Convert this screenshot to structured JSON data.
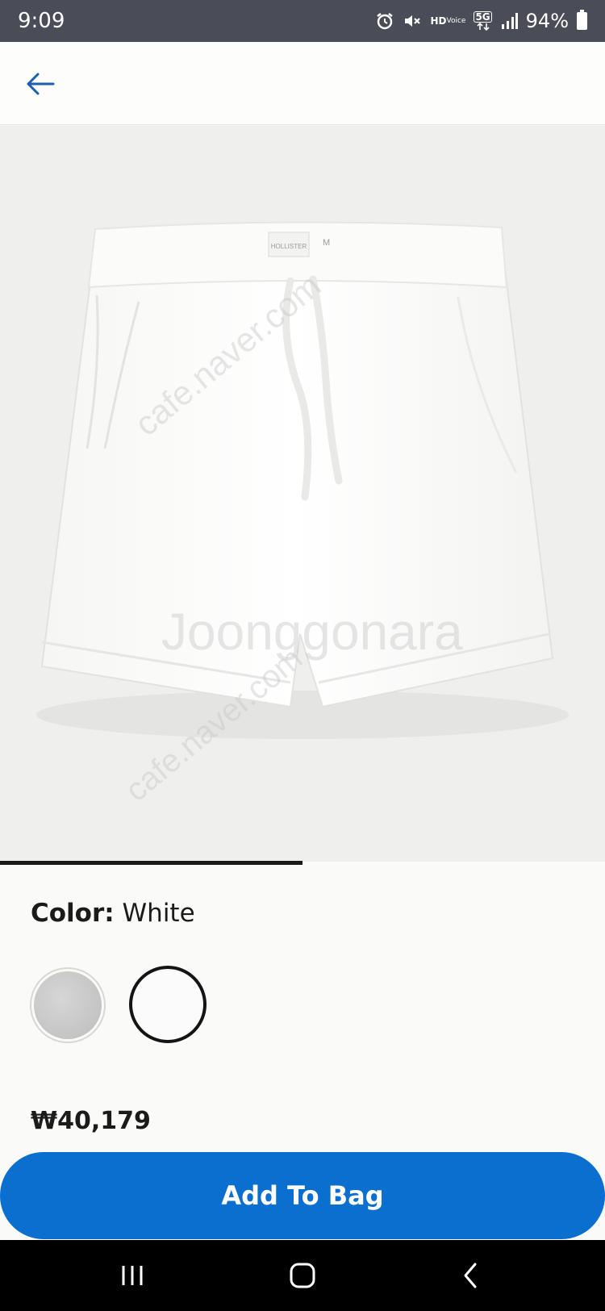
{
  "status_bar": {
    "time": "9:09",
    "battery": "94%",
    "icons": [
      "alarm-icon",
      "mute-icon",
      "hd-voice-icon",
      "5g-icon",
      "signal-icon",
      "battery-icon"
    ],
    "hd_top": "HD",
    "hd_bottom": "Voice",
    "network": "5G"
  },
  "header": {
    "back_icon": "arrow-left-icon"
  },
  "product": {
    "image_brand_tag": "HOLLISTER",
    "image_size_tag": "M",
    "watermarks": [
      "cafe.naver.com",
      "Joonggonara",
      "joonggonara"
    ]
  },
  "color": {
    "label": "Color:",
    "value": "White",
    "swatches": [
      {
        "name": "Grey",
        "selected": false
      },
      {
        "name": "White",
        "selected": true
      }
    ]
  },
  "price": "₩40,179",
  "cta": {
    "label": "Add To Bag"
  },
  "nav": {
    "icons": [
      "recents-icon",
      "home-icon",
      "back-icon"
    ]
  },
  "colors": {
    "accent": "#0a6fce",
    "status_bar": "#4a4d58",
    "back_arrow": "#1b5fae"
  }
}
